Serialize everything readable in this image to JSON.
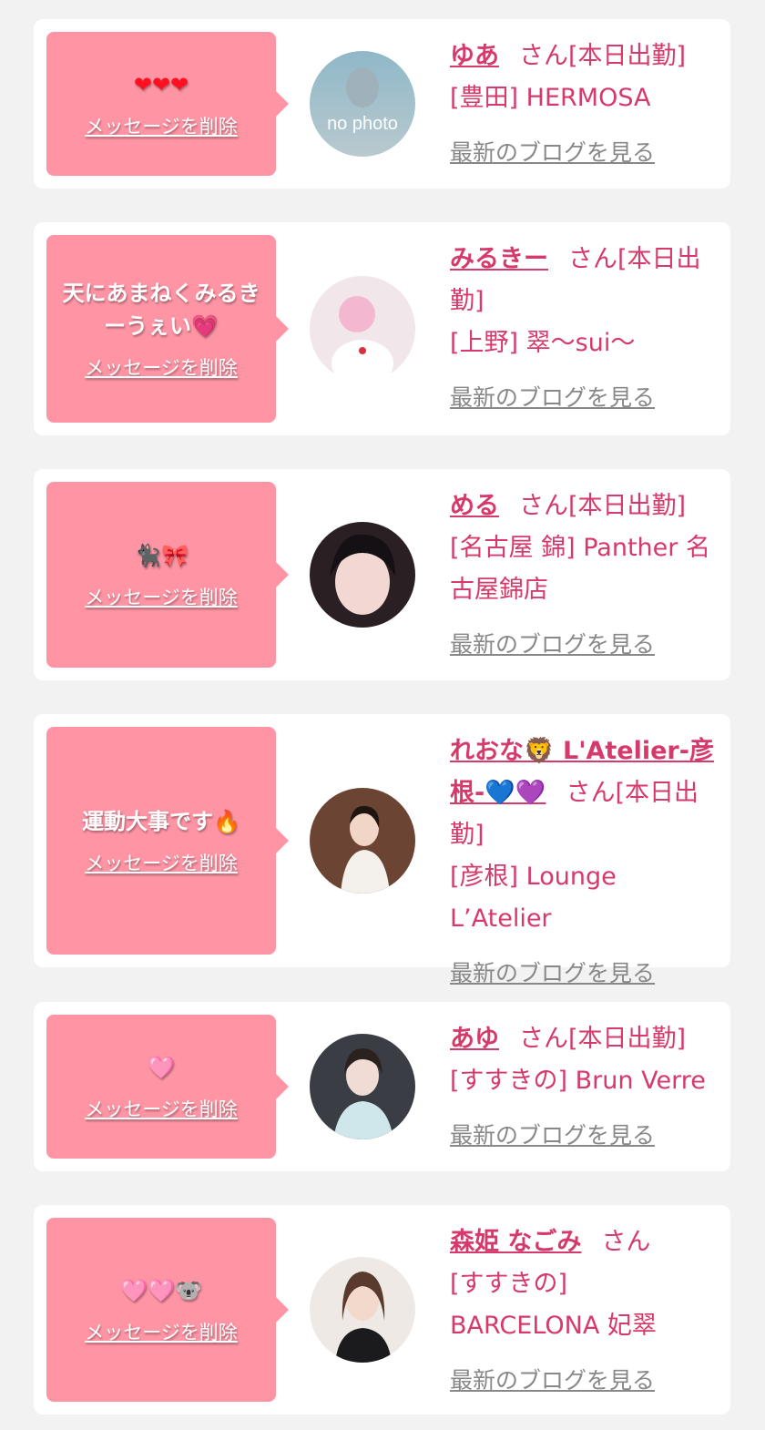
{
  "items": [
    {
      "message": "❤❤❤",
      "delete_label": "メッセージを削除",
      "name": "ゆあ",
      "suffix": "さん[本日出勤]",
      "shop": "[豊田] HERMOSA",
      "blog_label": "最新のブログを見る",
      "avatar_text": "no photo"
    },
    {
      "message": "天にあまねくみるきーうぇい💗",
      "delete_label": "メッセージを削除",
      "name": "みるきー",
      "suffix": "さん[本日出勤]",
      "shop": "[上野] 翠〜sui〜",
      "blog_label": "最新のブログを見る"
    },
    {
      "message": "🐈‍⬛🎀",
      "delete_label": "メッセージを削除",
      "name": "める",
      "suffix": "さん[本日出勤]",
      "shop": "[名古屋 錦] Panther 名古屋錦店",
      "blog_label": "最新のブログを見る"
    },
    {
      "message": "運動大事です🔥",
      "delete_label": "メッセージを削除",
      "name": "れおな🦁 L'Atelier-彦根-💙💜",
      "suffix": "さん[本日出勤]",
      "shop": "[彦根] Lounge L’Atelier",
      "blog_label": "最新のブログを見る"
    },
    {
      "message": "🩷",
      "delete_label": "メッセージを削除",
      "name": "あゆ",
      "suffix": "さん[本日出勤]",
      "shop": "[すすきの] Brun Verre",
      "blog_label": "最新のブログを見る"
    },
    {
      "message": "🩷🩷🐨",
      "delete_label": "メッセージを削除",
      "name": "森姫 なごみ",
      "suffix": "さん",
      "shop": "[すすきの] BARCELONA 妃翠",
      "blog_label": "最新のブログを見る"
    }
  ],
  "colors": {
    "bubble": "#ff94a4",
    "name": "#d63a6a",
    "link_gray": "#888888",
    "background": "#f2f2f2"
  }
}
